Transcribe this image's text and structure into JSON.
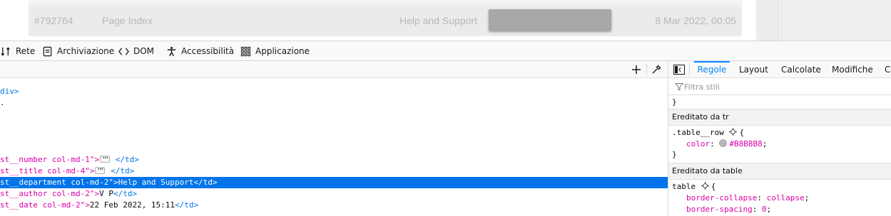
{
  "preview": {
    "row": {
      "number": "#792764",
      "title": "Page Index",
      "department": "Help and Support",
      "date": "8 Mar 2022, 00:05"
    }
  },
  "toolbar": {
    "tabs": [
      {
        "label": "Rete",
        "icon": "network-icon"
      },
      {
        "label": "Archiviazione",
        "icon": "storage-icon"
      },
      {
        "label": "DOM",
        "icon": "dom-icon"
      },
      {
        "label": "Accessibilità",
        "icon": "accessibility-icon"
      },
      {
        "label": "Applicazione",
        "icon": "application-icon"
      }
    ]
  },
  "markup": {
    "lines": [
      {
        "pre": "div>",
        "attr": "",
        "post": ""
      },
      {
        "pre": ".",
        "attr": "",
        "post": ""
      },
      {
        "pre": "st__number col-md-1\">",
        "post": "</td>"
      },
      {
        "pre": "st__title col-md-4\">",
        "post": "</td>"
      },
      {
        "pre": "st__department col-md-2\">",
        "text": "Help and Support",
        "post": "</td>"
      },
      {
        "pre": "st__author col-md-2\">",
        "text": "V P",
        "post": "</td>"
      },
      {
        "pre": "st__date col-md-2\">",
        "text": "22 Feb 2022, 15:11",
        "post": "</td>"
      }
    ]
  },
  "sidebar": {
    "tabs": [
      "Regole",
      "Layout",
      "Calcolate",
      "Modifiche",
      "Co"
    ],
    "active_tab": "Regole",
    "filter_placeholder": "Filtra stili",
    "closing_brace": "}",
    "inherited_tr": {
      "header": "Ereditato da tr",
      "selector": ".table__row",
      "open_brace": "{",
      "prop": "color",
      "value": "#B8B8B8",
      "close": "}"
    },
    "inherited_table": {
      "header": "Ereditato da table",
      "selector": "table",
      "open_brace": "{",
      "decls": [
        {
          "prop": "border-collapse",
          "value": "collapse"
        },
        {
          "prop": "border-spacing",
          "value": "0"
        }
      ]
    }
  },
  "colors": {
    "accent": "#0a84ff",
    "selection": "#0074e8",
    "swatch": "#B8B8B8"
  }
}
